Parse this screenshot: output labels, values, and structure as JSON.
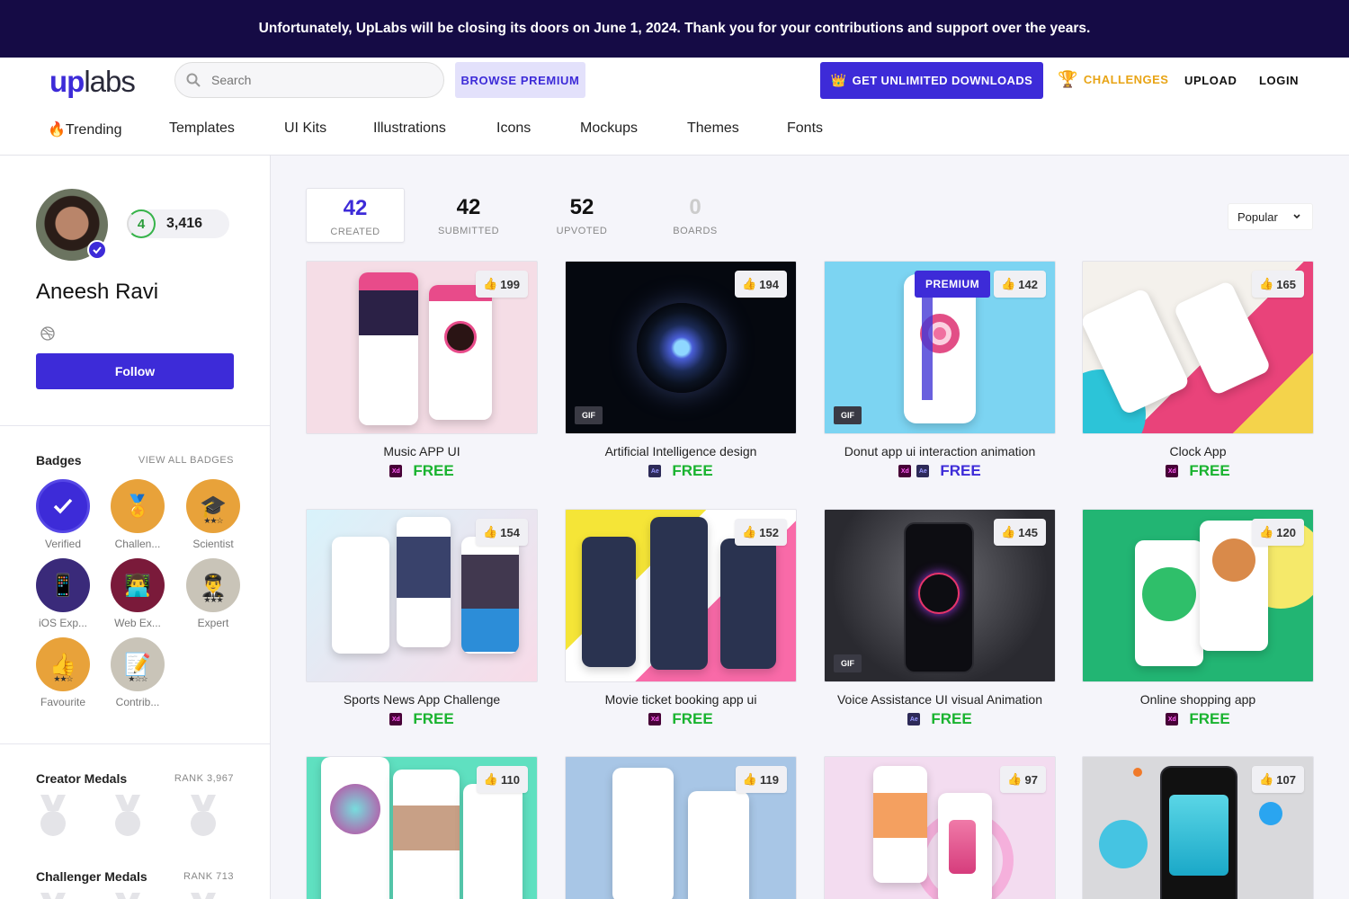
{
  "banner": {
    "text": "Unfortunately, UpLabs will be closing its doors on June 1, 2024. Thank you for your contributions and support over the years."
  },
  "header": {
    "logo": {
      "up": "up",
      "labs": "labs"
    },
    "search_placeholder": "Search",
    "browse_premium": "BROWSE PREMIUM",
    "unlimited_downloads": "GET UNLIMITED DOWNLOADS",
    "challenges": "CHALLENGES",
    "upload": "UPLOAD",
    "login": "LOGIN"
  },
  "categories": [
    "🔥Trending",
    "Templates",
    "UI Kits",
    "Illustrations",
    "Icons",
    "Mockups",
    "Themes",
    "Fonts"
  ],
  "profile": {
    "level": "4",
    "points": "3,416",
    "name": "Aneesh Ravi",
    "follow_label": "Follow"
  },
  "badges_section": {
    "title": "Badges",
    "view_all": "VIEW ALL BADGES",
    "items": [
      {
        "label": "Verified",
        "icon": "check-icon",
        "color": "#3d2bd8"
      },
      {
        "label": "Challen...",
        "icon": "trophy-icon",
        "color": "#e8a23a"
      },
      {
        "label": "Scientist",
        "icon": "graduation-cap-icon",
        "color": "#e8a23a"
      },
      {
        "label": "iOS Exp...",
        "icon": "iphone-icon",
        "color": "#3a2a7a"
      },
      {
        "label": "Web Ex...",
        "icon": "laptop-icon",
        "color": "#7a1a3a"
      },
      {
        "label": "Expert",
        "icon": "expert-icon",
        "color": "#c9c4b8"
      },
      {
        "label": "Favourite",
        "icon": "thumbs-up-icon",
        "color": "#e8a23a"
      },
      {
        "label": "Contrib...",
        "icon": "notepad-icon",
        "color": "#c9c4b8"
      }
    ]
  },
  "creator_medals": {
    "title": "Creator Medals",
    "rank": "RANK 3,967"
  },
  "challenger_medals": {
    "title": "Challenger Medals",
    "rank": "RANK 713"
  },
  "stats": [
    {
      "value": "42",
      "label": "CREATED",
      "active": true
    },
    {
      "value": "42",
      "label": "SUBMITTED",
      "active": false
    },
    {
      "value": "52",
      "label": "UPVOTED",
      "active": false
    },
    {
      "value": "0",
      "label": "BOARDS",
      "active": false
    }
  ],
  "sort": {
    "selected": "Popular"
  },
  "cards": [
    {
      "title": "Music APP UI",
      "likes": "199",
      "price": "FREE",
      "tools": [
        "Xd"
      ]
    },
    {
      "title": "Artificial Intelligence design",
      "likes": "194",
      "price": "FREE",
      "tools": [
        "Ae"
      ],
      "gif": "GIF"
    },
    {
      "title": "Donut app ui interaction animation",
      "likes": "142",
      "price": "FREE",
      "tools": [
        "Xd",
        "Ae"
      ],
      "gif": "GIF",
      "premium": "PREMIUM"
    },
    {
      "title": "Clock App",
      "likes": "165",
      "price": "FREE",
      "tools": [
        "Xd"
      ]
    },
    {
      "title": "Sports News App Challenge",
      "likes": "154",
      "price": "FREE",
      "tools": [
        "Xd"
      ]
    },
    {
      "title": "Movie ticket booking app ui",
      "likes": "152",
      "price": "FREE",
      "tools": [
        "Xd"
      ]
    },
    {
      "title": "Voice Assistance UI visual Animation",
      "likes": "145",
      "price": "FREE",
      "tools": [
        "Ae"
      ],
      "gif": "GIF"
    },
    {
      "title": "Online shopping app",
      "likes": "120",
      "price": "FREE",
      "tools": [
        "Xd"
      ]
    },
    {
      "title": "",
      "likes": "110"
    },
    {
      "title": "",
      "likes": "119"
    },
    {
      "title": "",
      "likes": "97"
    },
    {
      "title": "",
      "likes": "107"
    }
  ],
  "colors": {
    "brand": "#3d2bd8",
    "banner": "#150b45",
    "free_green": "#19b32f",
    "challenges_gold": "#e8a415"
  }
}
